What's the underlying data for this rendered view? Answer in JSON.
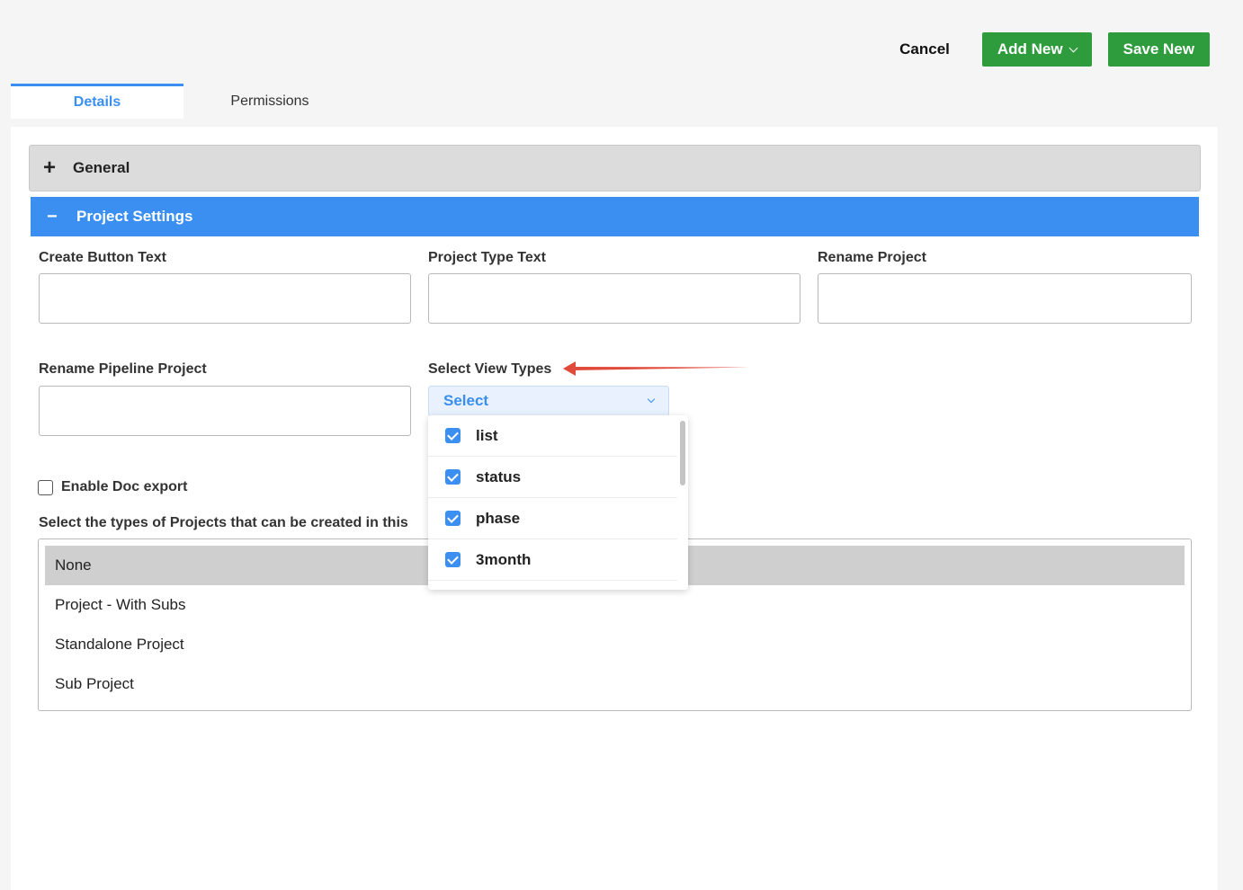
{
  "toolbar": {
    "cancel_label": "Cancel",
    "add_new_label": "Add New",
    "save_new_label": "Save New"
  },
  "tabs": [
    {
      "label": "Details",
      "active": true
    },
    {
      "label": "Permissions",
      "active": false
    }
  ],
  "accordion": {
    "general": {
      "label": "General",
      "sign": "+"
    },
    "project_settings": {
      "label": "Project Settings",
      "sign": "−"
    }
  },
  "fields": {
    "create_button_text": {
      "label": "Create Button Text",
      "value": ""
    },
    "project_type_text": {
      "label": "Project Type Text",
      "value": ""
    },
    "rename_project": {
      "label": "Rename Project",
      "value": ""
    },
    "rename_pipeline_project": {
      "label": "Rename Pipeline Project",
      "value": ""
    },
    "select_view_types": {
      "label": "Select View Types",
      "selected": "Select"
    }
  },
  "view_type_options": [
    {
      "label": "list",
      "checked": true
    },
    {
      "label": "status",
      "checked": true
    },
    {
      "label": "phase",
      "checked": true
    },
    {
      "label": "3month",
      "checked": true
    }
  ],
  "enable_doc_export": {
    "label": "Enable Doc export",
    "checked": false
  },
  "project_types": {
    "label": "Select the types of Projects that can be created in this",
    "options": [
      {
        "label": "None",
        "selected": true
      },
      {
        "label": "Project - With Subs",
        "selected": false
      },
      {
        "label": "Standalone Project",
        "selected": false
      },
      {
        "label": "Sub Project",
        "selected": false
      }
    ]
  },
  "colors": {
    "accent": "#3b8ff0",
    "green": "#2e9c3c",
    "annotation_arrow": "#e04a3a"
  }
}
